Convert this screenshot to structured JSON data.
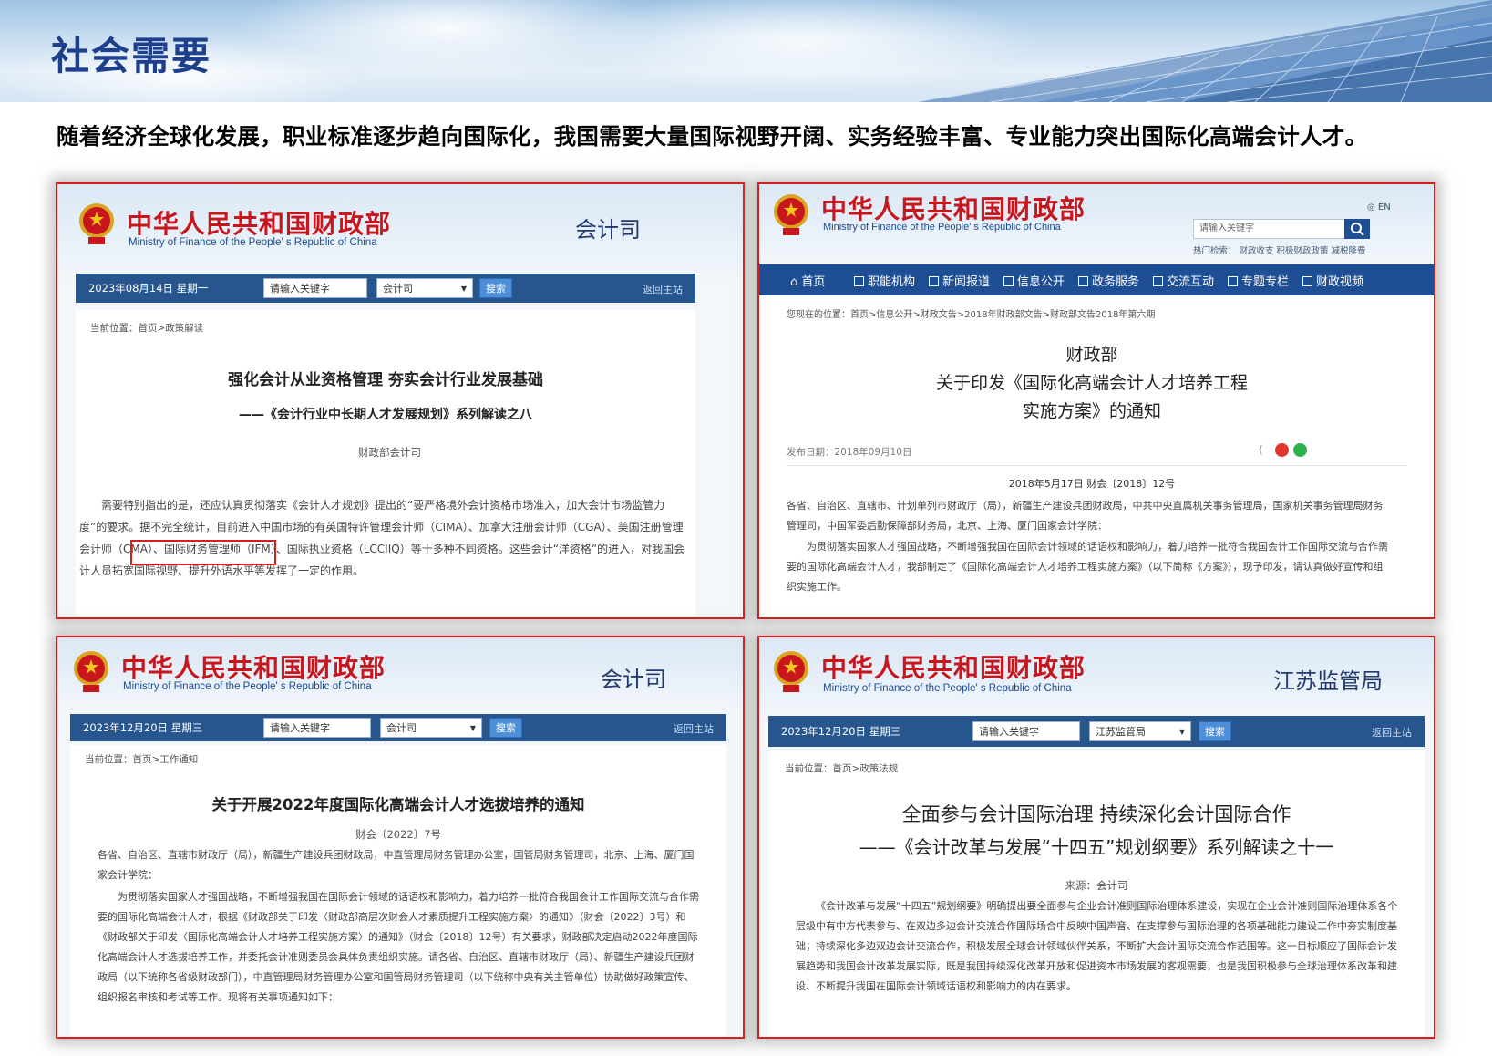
{
  "page": {
    "title": "社会需要",
    "subtitle": "随着经济全球化发展，职业标准逐步趋向国际化，我国需要大量国际视野开阔、实务经验丰富、专业能力突出国际化高端会计人才。"
  },
  "ministry": {
    "name_cn": "中华人民共和国财政部",
    "name_en": "Ministry of Finance of the People' s Republic of China"
  },
  "shot1": {
    "dept": "会计司",
    "date": "2023年08月14日  星期一",
    "search_placeholder": "请输入关键字",
    "select_value": "会计司",
    "search_button": "搜索",
    "home_link": "返回主站",
    "breadcrumb": "当前位置：首页>政策解读",
    "heading": "强化会计从业资格管理 夯实会计行业发展基础",
    "subheading": "——《会计行业中长期人才发展规划》系列解读之八",
    "source": "财政部会计司",
    "body": "需要特别指出的是，还应认真贯彻落实《会计人才规划》提出的“要严格境外会计资格市场准入，加大会计市场监管力度”的要求。据不完全统计，目前进入中国市场的有英国特许管理会计师（CIMA）、加拿大注册会计师（CGA）、美国注册管理会计师（CMA）、国际财务管理师（IFM）、国际执业资格（LCCIIQ）等十多种不同资格。这些会计“洋资格”的进入，对我国会计人员拓宽国际视野、提升外语水平等发挥了一定的作用。"
  },
  "shot2": {
    "en_link": "EN",
    "search_placeholder": "请输入关键字",
    "hot_search": "热门检索：    财政收支    积极财政政策    减税降费",
    "nav": [
      "首页",
      "职能机构",
      "新闻报道",
      "信息公开",
      "政务服务",
      "交流互动",
      "专题专栏",
      "财政视频"
    ],
    "breadcrumb": "您现在的位置：首页>信息公开>财政文告>2018年财政部文告>财政部文告2018年第六期",
    "title_line1": "财政部",
    "title_line2": "关于印发《国际化高端会计人才培养工程",
    "title_line3": "实施方案》的通知",
    "publish_date": "发布日期：2018年09月10日",
    "doc_no": "2018年5月17日 财会〔2018〕12号",
    "recipients": "各省、自治区、直辖市、计划单列市财政厅（局），新疆生产建设兵团财政局，中共中央直属机关事务管理局，国家机关事务管理局财务管理司，中国军委后勤保障部财务局，北京、上海、厦门国家会计学院：",
    "body": "为贯彻落实国家人才强国战略，不断增强我国在国际会计领域的话语权和影响力，着力培养一批符合我国会计工作国际交流与合作需要的国际化高端会计人才，我部制定了《国际化高端会计人才培养工程实施方案》（以下简称《方案》），现予印发，请认真做好宣传和组织实施工作。"
  },
  "shot3": {
    "dept": "会计司",
    "date": "2023年12月20日  星期三",
    "search_placeholder": "请输入关键字",
    "select_value": "会计司",
    "search_button": "搜索",
    "home_link": "返回主站",
    "breadcrumb": "当前位置：首页>工作通知",
    "heading": "关于开展2022年度国际化高端会计人才选拔培养的通知",
    "doc_no": "财会〔2022〕7号",
    "recipients": "各省、自治区、直辖市财政厅（局），新疆生产建设兵团财政局，中直管理局财务管理办公室，国管局财务管理司，北京、上海、厦门国家会计学院：",
    "body": "为贯彻落实国家人才强国战略，不断增强我国在国际会计领域的话语权和影响力，着力培养一批符合我国会计工作国际交流与合作需要的国际化高端会计人才，根据《财政部关于印发〈财政部高层次财会人才素质提升工程实施方案〉的通知》（财会〔2022〕3号）和《财政部关于印发〈国际化高端会计人才培养工程实施方案〉的通知》（财会〔2018〕12号）有关要求，财政部决定启动2022年度国际化高端会计人才选拔培养工作，并委托会计准则委员会具体负责组织实施。请各省、自治区、直辖市财政厅（局）、新疆生产建设兵团财政局（以下统称各省级财政部门），中直管理局财务管理办公室和国管局财务管理司（以下统称中央有关主管单位）协助做好政策宣传、组织报名审核和考试等工作。现将有关事项通知如下："
  },
  "shot4": {
    "dept": "江苏监管局",
    "date": "2023年12月20日  星期三",
    "search_placeholder": "请输入关键字",
    "select_value": "江苏监管局",
    "search_button": "搜索",
    "home_link": "返回主站",
    "breadcrumb": "当前位置：首页>政策法规",
    "heading_line1": "全面参与会计国际治理 持续深化会计国际合作",
    "heading_line2": "——《会计改革与发展“十四五”规划纲要》系列解读之十一",
    "source": "来源：会计司",
    "body": "《会计改革与发展“十四五”规划纲要》明确提出要全面参与企业会计准则国际治理体系建设，实现在企业会计准则国际治理体系各个层级中有中方代表参与、在双边多边会计交流合作国际场合中反映中国声音、在支撑参与国际治理的各项基础能力建设工作中夯实制度基础；持续深化多边双边会计交流合作，积极发展全球会计领域伙伴关系，不断扩大会计国际交流合作范围等。这一目标顺应了国际会计发展趋势和我国会计改革发展实际，既是我国持续深化改革开放和促进资本市场发展的客观需要，也是我国积极参与全球治理体系改革和建设、不断提升我国在国际会计领域话语权和影响力的内在要求。"
  },
  "colors": {
    "title_blue": "#1d3f8c",
    "frame_red": "#d51e1e",
    "ministry_red": "#c8161d",
    "bar_blue": "#27558e",
    "nav_blue": "#1e4f95"
  },
  "icons": [
    "national-emblem-icon",
    "home-icon",
    "search-icon",
    "share-icon",
    "weibo-icon",
    "wechat-icon",
    "globe-icon"
  ]
}
